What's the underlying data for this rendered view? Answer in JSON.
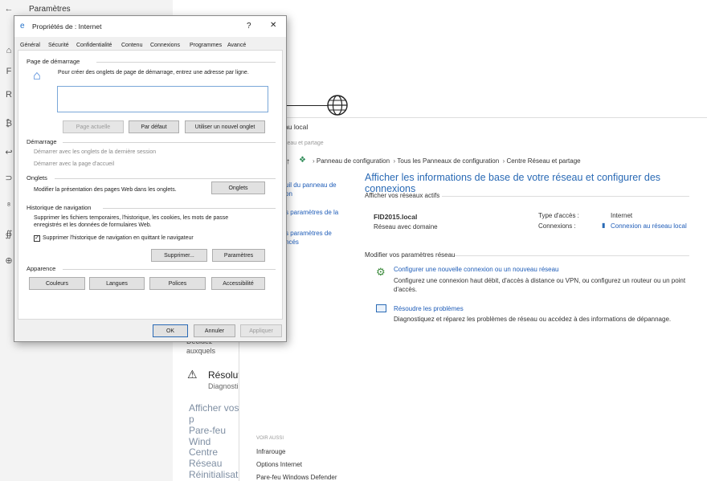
{
  "settings": {
    "title": "Paramètres",
    "partial_lines": [
      "Décidez",
      "auxquels",
      "Résoluti",
      "Diagnosti"
    ],
    "links": [
      "Afficher vos p",
      "Pare-feu Wind",
      "Centre Réseau",
      "Réinitialisatio"
    ]
  },
  "control_panel": {
    "title_partial": "au local",
    "subtitle_partial": "seau et partage",
    "breadcrumb": [
      "Panneau de configuration",
      "Tous les Panneaux de configuration",
      "Centre Réseau et partage"
    ],
    "left_nav": [
      "uil du panneau de",
      "on",
      "s paramètres de la",
      "s paramètres de",
      "ncés"
    ],
    "heading": "Afficher les informations de base de votre réseau et configurer des connexions",
    "active_networks_label": "Afficher vos réseaux actifs",
    "network_name": "FID2015.local",
    "network_type": "Réseau avec domaine",
    "access_type_label": "Type d'accès :",
    "access_type_value": "Internet",
    "connections_label": "Connexions :",
    "connections_value": "Connexion au réseau local",
    "modify_label": "Modifier vos paramètres réseau",
    "task1_title": "Configurer une nouvelle connexion ou un nouveau réseau",
    "task1_desc": "Configurez une connexion haut débit, d'accès à distance ou VPN, ou configurez un routeur ou un point d'accès.",
    "task2_title": "Résoudre les problèmes",
    "task2_desc": "Diagnostiquez et réparez les problèmes de réseau ou accédez à des informations de dépannage.",
    "see_also": "Voir aussi",
    "see_also_links": [
      "Infrarouge",
      "Options Internet",
      "Pare-feu Windows Defender"
    ]
  },
  "dialog": {
    "title": "Propriétés de : Internet",
    "help": "?",
    "close": "✕",
    "tabs": [
      "Général",
      "Sécurité",
      "Confidentialité",
      "Contenu",
      "Connexions",
      "Programmes",
      "Avancé"
    ],
    "home_section": "Page de démarrage",
    "home_desc": "Pour créer des onglets de page de démarrage, entrez une adresse par ligne.",
    "home_value": "",
    "btn_current": "Page actuelle",
    "btn_default": "Par défaut",
    "btn_newtab": "Utiliser un nouvel onglet",
    "startup_section": "Démarrage",
    "startup_opt1": "Démarrer avec les onglets de la dernière session",
    "startup_opt2": "Démarrer avec la page d'accueil",
    "tabs_section": "Onglets",
    "tabs_desc": "Modifier la présentation des pages Web dans les onglets.",
    "btn_tabs": "Onglets",
    "history_section": "Historique de navigation",
    "history_desc": "Supprimer les fichiers temporaires, l'historique, les cookies, les mots de passe enregistrés et les données de formulaires Web.",
    "history_check": "Supprimer l'historique de navigation en quittant le navigateur",
    "btn_delete": "Supprimer...",
    "btn_settings": "Paramètres",
    "appearance_section": "Apparence",
    "btn_colors": "Couleurs",
    "btn_languages": "Langues",
    "btn_fonts": "Polices",
    "btn_access": "Accessibilité",
    "btn_ok": "OK",
    "btn_cancel": "Annuler",
    "btn_apply": "Appliquer"
  }
}
